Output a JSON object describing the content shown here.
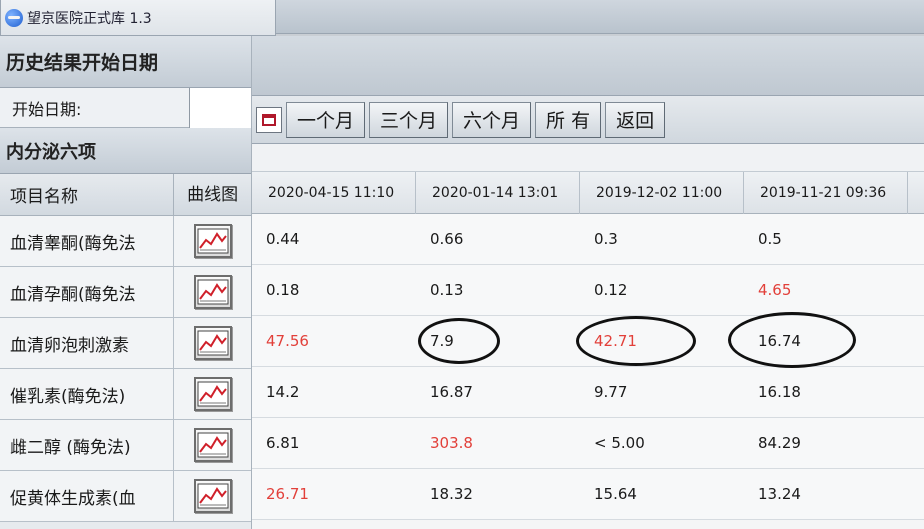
{
  "window": {
    "title": "望京医院正式库 1.3"
  },
  "left": {
    "section_history": "历史结果开始日期",
    "start_label": "开始日期:",
    "start_value": "",
    "section_panel": "内分泌六项",
    "col_name": "项目名称",
    "col_curve": "曲线图",
    "items": [
      {
        "name": "血清睾酮(酶免法"
      },
      {
        "name": "血清孕酮(酶免法"
      },
      {
        "name": "血清卵泡刺激素"
      },
      {
        "name": "催乳素(酶免法)"
      },
      {
        "name": "雌二醇 (酶免法)"
      },
      {
        "name": "促黄体生成素(血"
      }
    ]
  },
  "toolbar": {
    "buttons": [
      "一个月",
      "三个月",
      "六个月",
      "所 有",
      "返回"
    ]
  },
  "table": {
    "dates": [
      "2020-04-15 11:10",
      "2020-01-14 13:01",
      "2019-12-02 11:00",
      "2019-11-21 09:36"
    ],
    "rows": [
      [
        "0.44",
        "0.66",
        "0.3",
        "0.5"
      ],
      [
        "0.18",
        "0.13",
        "0.12",
        "4.65"
      ],
      [
        "47.56",
        "7.9",
        "42.71",
        "16.74"
      ],
      [
        "14.2",
        "16.87",
        "9.77",
        "16.18"
      ],
      [
        "6.81",
        "303.8",
        "< 5.00",
        "84.29"
      ],
      [
        "26.71",
        "18.32",
        "15.64",
        "13.24"
      ]
    ]
  },
  "colors": {
    "abnormal": "#e2403a",
    "normal": "#1a1a1a"
  }
}
